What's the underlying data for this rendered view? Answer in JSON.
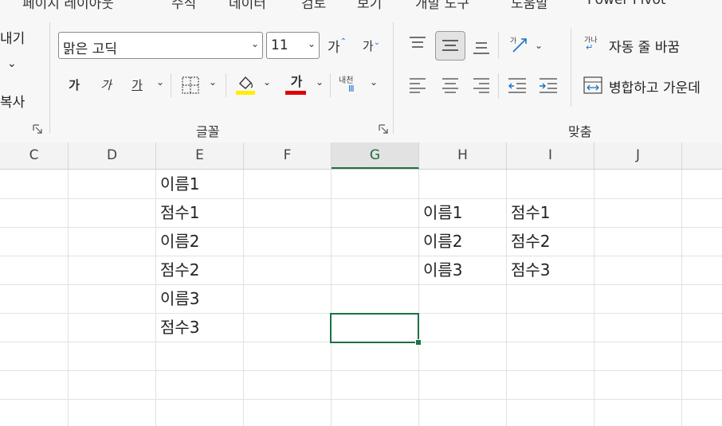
{
  "ribbon": {
    "menu_strip": [
      "페이지 레이아웃",
      "수식",
      "데이터",
      "검토",
      "보기",
      "개발 도구",
      "도움말",
      "Power Pivot"
    ],
    "clipboard": {
      "partial_label_top": "내기",
      "partial_label_copy": "복사",
      "dropdown_glyph": "⌄"
    },
    "font": {
      "font_name": "맑은 고딕",
      "font_size": "11",
      "increase_label": "가",
      "decrease_label": "가",
      "bold_label": "가",
      "italic_label": "가",
      "underline_label": "가",
      "font_color_label": "가",
      "phonetic_top": "내천",
      "phonetic_bottom": "Ⅲ",
      "group_label": "글꼴",
      "fill_color": "#ffee00",
      "font_color": "#e00000"
    },
    "alignment": {
      "wrap_text_label": "자동 줄 바꿈",
      "merge_label": "병합하고 가운데",
      "group_label": "맞춤",
      "wrap_icon_text": "가나"
    }
  },
  "sheet": {
    "columns": [
      "C",
      "D",
      "E",
      "F",
      "G",
      "H",
      "I",
      "J"
    ],
    "selected_column": "G",
    "column_E": [
      "이름1",
      "점수1",
      "이름2",
      "점수2",
      "이름3",
      "점수3"
    ],
    "table_H": [
      "이름1",
      "이름2",
      "이름3"
    ],
    "table_I": [
      "점수1",
      "점수2",
      "점수3"
    ]
  }
}
